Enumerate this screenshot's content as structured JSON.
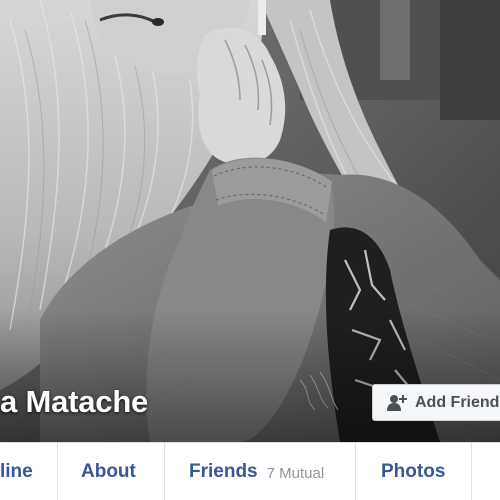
{
  "profile": {
    "name": "a Matache"
  },
  "actions": {
    "add_friend_label": "Add Friend",
    "add_friend_icon": "add-friend-icon"
  },
  "nav": {
    "tabs": [
      {
        "label": "line"
      },
      {
        "label": "About"
      },
      {
        "label": "Friends",
        "count": "7 Mutual"
      },
      {
        "label": "Photos"
      }
    ]
  },
  "colors": {
    "link_blue": "#365899",
    "muted_gray": "#90949c",
    "button_bg": "#f6f7f9",
    "button_text": "#4b4f56"
  }
}
